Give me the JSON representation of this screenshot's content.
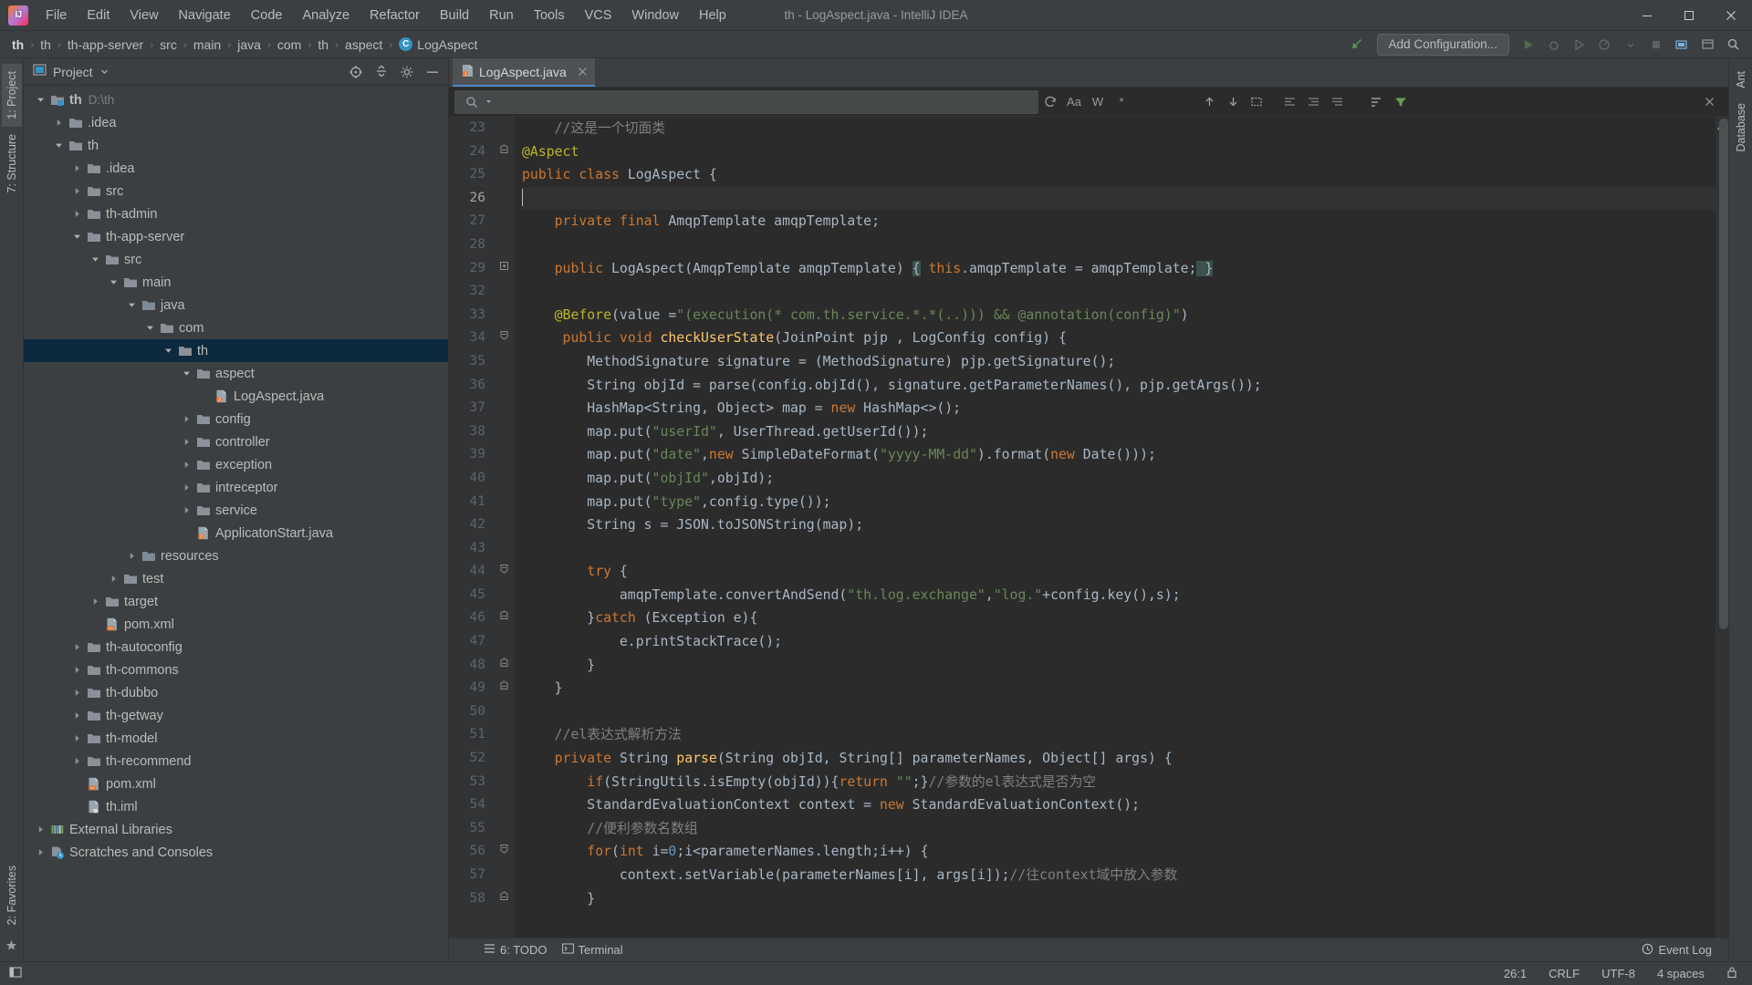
{
  "window": {
    "title": "th - LogAspect.java - IntelliJ IDEA",
    "logo_icon": "intellij-idea-logo",
    "minimize_icon": "minimize-icon",
    "maximize_icon": "maximize-icon",
    "close_icon": "close-icon"
  },
  "menubar": {
    "items": [
      {
        "label": "File"
      },
      {
        "label": "Edit"
      },
      {
        "label": "View"
      },
      {
        "label": "Navigate"
      },
      {
        "label": "Code"
      },
      {
        "label": "Analyze"
      },
      {
        "label": "Refactor"
      },
      {
        "label": "Build"
      },
      {
        "label": "Run"
      },
      {
        "label": "Tools"
      },
      {
        "label": "VCS"
      },
      {
        "label": "Window"
      },
      {
        "label": "Help"
      }
    ]
  },
  "navbar": {
    "crumbs": [
      {
        "label": "th",
        "bold": true
      },
      {
        "label": "th"
      },
      {
        "label": "th-app-server"
      },
      {
        "label": "src"
      },
      {
        "label": "main"
      },
      {
        "label": "java"
      },
      {
        "label": "com"
      },
      {
        "label": "th"
      },
      {
        "label": "aspect"
      },
      {
        "label": "LogAspect",
        "icon": "C"
      }
    ],
    "separator": "›",
    "build_icon": "hammer-icon",
    "run_config_label": "Add Configuration...",
    "icons": [
      "run-icon",
      "debug-icon",
      "run-coverage-icon",
      "profiler-icon",
      "chevron-down-icon",
      "stop-icon",
      "update-project-icon",
      "settings-icon",
      "search-everywhere-icon"
    ]
  },
  "left_strip": {
    "tabs": [
      {
        "label": "1: Project",
        "active": true
      },
      {
        "label": "7: Structure",
        "active": false
      }
    ],
    "bottom_tabs": [
      {
        "label": "2: Favorites"
      }
    ]
  },
  "right_strip": {
    "tabs": [
      {
        "label": "Ant"
      },
      {
        "label": "Database"
      }
    ]
  },
  "project_panel": {
    "title": "Project",
    "title_icon": "project-view-icon",
    "caret_icon": "chevron-down-icon",
    "locate_icon": "scroll-from-source-icon",
    "collapse_icon": "collapse-all-icon",
    "settings_icon": "gear-icon",
    "hide_icon": "hide-icon",
    "tree": [
      {
        "indent": 0,
        "arrow": "down",
        "icon": "project-folder",
        "label": "th",
        "bold": true,
        "sub": "D:\\th"
      },
      {
        "indent": 1,
        "arrow": "right",
        "icon": "folder",
        "label": ".idea"
      },
      {
        "indent": 1,
        "arrow": "down",
        "icon": "folder",
        "label": "th"
      },
      {
        "indent": 2,
        "arrow": "right",
        "icon": "folder",
        "label": ".idea"
      },
      {
        "indent": 2,
        "arrow": "right",
        "icon": "folder",
        "label": "src"
      },
      {
        "indent": 2,
        "arrow": "right",
        "icon": "folder",
        "label": "th-admin"
      },
      {
        "indent": 2,
        "arrow": "down",
        "icon": "folder",
        "label": "th-app-server"
      },
      {
        "indent": 3,
        "arrow": "down",
        "icon": "folder",
        "label": "src"
      },
      {
        "indent": 4,
        "arrow": "down",
        "icon": "folder",
        "label": "main"
      },
      {
        "indent": 5,
        "arrow": "down",
        "icon": "source-folder",
        "label": "java"
      },
      {
        "indent": 6,
        "arrow": "down",
        "icon": "package",
        "label": "com"
      },
      {
        "indent": 7,
        "arrow": "down",
        "icon": "package",
        "label": "th",
        "selected": true
      },
      {
        "indent": 8,
        "arrow": "down",
        "icon": "package",
        "label": "aspect"
      },
      {
        "indent": 9,
        "arrow": "none",
        "icon": "java-file",
        "label": "LogAspect.java"
      },
      {
        "indent": 8,
        "arrow": "right",
        "icon": "package",
        "label": "config"
      },
      {
        "indent": 8,
        "arrow": "right",
        "icon": "package",
        "label": "controller"
      },
      {
        "indent": 8,
        "arrow": "right",
        "icon": "package",
        "label": "exception"
      },
      {
        "indent": 8,
        "arrow": "right",
        "icon": "package",
        "label": "intreceptor"
      },
      {
        "indent": 8,
        "arrow": "right",
        "icon": "package",
        "label": "service"
      },
      {
        "indent": 8,
        "arrow": "none",
        "icon": "java-file",
        "label": "ApplicatonStart.java"
      },
      {
        "indent": 5,
        "arrow": "right",
        "icon": "resource-folder",
        "label": "resources"
      },
      {
        "indent": 4,
        "arrow": "right",
        "icon": "folder",
        "label": "test"
      },
      {
        "indent": 3,
        "arrow": "right",
        "icon": "folder",
        "label": "target"
      },
      {
        "indent": 3,
        "arrow": "none",
        "icon": "xml-file",
        "label": "pom.xml"
      },
      {
        "indent": 2,
        "arrow": "right",
        "icon": "folder",
        "label": "th-autoconfig"
      },
      {
        "indent": 2,
        "arrow": "right",
        "icon": "folder",
        "label": "th-commons"
      },
      {
        "indent": 2,
        "arrow": "right",
        "icon": "folder",
        "label": "th-dubbo"
      },
      {
        "indent": 2,
        "arrow": "right",
        "icon": "folder",
        "label": "th-getway"
      },
      {
        "indent": 2,
        "arrow": "right",
        "icon": "folder",
        "label": "th-model"
      },
      {
        "indent": 2,
        "arrow": "right",
        "icon": "folder",
        "label": "th-recommend"
      },
      {
        "indent": 2,
        "arrow": "none",
        "icon": "xml-file",
        "label": "pom.xml"
      },
      {
        "indent": 2,
        "arrow": "none",
        "icon": "iml-file",
        "label": "th.iml"
      },
      {
        "indent": 0,
        "arrow": "right",
        "icon": "libraries",
        "label": "External Libraries"
      },
      {
        "indent": 0,
        "arrow": "right",
        "icon": "scratches",
        "label": "Scratches and Consoles"
      }
    ]
  },
  "editor": {
    "tab": {
      "label": "LogAspect.java",
      "icon": "java-file",
      "close_icon": "close-icon"
    },
    "findbar": {
      "search_icon": "search-icon",
      "dropdown_icon": "chevron-down-icon",
      "value": "",
      "placeholder": "",
      "history_icon": "history-icon",
      "match_case_icon": "Aa",
      "words_icon": "W",
      "regex_icon": "*",
      "prev_icon": "arrow-up-icon",
      "next_icon": "arrow-down-icon",
      "select_all_icon": "select-all-icon",
      "filter_icon": "filter-icon",
      "expand_icon": "expand-icon",
      "collapse_icon": "collapse-icon",
      "close_icon": "close-icon"
    },
    "caret_position": "26:1",
    "inspection_status": "ok-check-icon",
    "lines": [
      {
        "n": "23",
        "fold": "",
        "html": "    <span class=\"cmt\">//这是一个切面类</span>"
      },
      {
        "n": "24",
        "fold": "minus",
        "html": "<span class=\"ann\">@Aspect</span>"
      },
      {
        "n": "25",
        "fold": "",
        "html": "<span class=\"kw\">public class</span> <span class=\"txt\">LogAspect</span> {"
      },
      {
        "n": "26",
        "fold": "",
        "html": "<span class=\"caret\"></span>",
        "current": true
      },
      {
        "n": "27",
        "fold": "",
        "html": "    <span class=\"kw\">private final</span> AmqpTemplate amqpTemplate;"
      },
      {
        "n": "28",
        "fold": "",
        "html": ""
      },
      {
        "n": "29",
        "fold": "plus",
        "html": "    <span class=\"kw\">public</span> <span class=\"txt\">LogAspect</span>(AmqpTemplate amqpTemplate) <span class=\"hl\">{</span> <span class=\"kw\">this</span>.amqpTemplate = amqpTemplate;<span class=\"hl\"> }</span>"
      },
      {
        "n": "32",
        "fold": "",
        "html": ""
      },
      {
        "n": "33",
        "fold": "",
        "html": "    <span class=\"ann\">@Before</span>(value =<span class=\"str\">\"(execution(* com.th.service.*.*(..))) &amp;&amp; @annotation(config)\"</span>)"
      },
      {
        "n": "34",
        "fold": "minus2",
        "html": "     <span class=\"kw\">public void</span> <span class=\"fn\">checkUserState</span>(JoinPoint pjp , LogConfig config) {",
        "current": false
      },
      {
        "n": "35",
        "fold": "",
        "html": "        MethodSignature signature = (MethodSignature) pjp.getSignature();"
      },
      {
        "n": "36",
        "fold": "",
        "html": "        String objId = parse(config.objId(), signature.getParameterNames(), pjp.getArgs());"
      },
      {
        "n": "37",
        "fold": "",
        "html": "        HashMap&lt;String, Object&gt; map = <span class=\"kw\">new</span> HashMap&lt;&gt;();"
      },
      {
        "n": "38",
        "fold": "",
        "html": "        map.put(<span class=\"str\">\"userId\"</span>, UserThread.getUserId());"
      },
      {
        "n": "39",
        "fold": "",
        "html": "        map.put(<span class=\"str\">\"date\"</span>,<span class=\"kw\">new</span> SimpleDateFormat(<span class=\"str\">\"yyyy-MM-dd\"</span>).format(<span class=\"kw\">new</span> Date()));"
      },
      {
        "n": "40",
        "fold": "",
        "html": "        map.put(<span class=\"str\">\"objId\"</span>,objId);"
      },
      {
        "n": "41",
        "fold": "",
        "html": "        map.put(<span class=\"str\">\"type\"</span>,config.type());"
      },
      {
        "n": "42",
        "fold": "",
        "html": "        String s = JSON.toJSONString(map);"
      },
      {
        "n": "43",
        "fold": "",
        "html": ""
      },
      {
        "n": "44",
        "fold": "minus2",
        "html": "        <span class=\"kw\">try</span> {"
      },
      {
        "n": "45",
        "fold": "",
        "html": "            amqpTemplate.convertAndSend(<span class=\"str\">\"th.log.exchange\"</span>,<span class=\"str\">\"log.\"</span>+config.key(),s);"
      },
      {
        "n": "46",
        "fold": "minus",
        "html": "        }<span class=\"kw\">catch</span> (Exception e){"
      },
      {
        "n": "47",
        "fold": "",
        "html": "            e.printStackTrace();"
      },
      {
        "n": "48",
        "fold": "minus",
        "html": "        }"
      },
      {
        "n": "49",
        "fold": "minus",
        "html": "    }"
      },
      {
        "n": "50",
        "fold": "",
        "html": ""
      },
      {
        "n": "51",
        "fold": "",
        "html": "    <span class=\"cmt\">//el表达式解析方法</span>"
      },
      {
        "n": "52",
        "fold": "",
        "html": "    <span class=\"kw\">private</span> String <span class=\"fn\">parse</span>(String objId, String[] parameterNames, Object[] args) {"
      },
      {
        "n": "53",
        "fold": "",
        "html": "        <span class=\"kw\">if</span>(StringUtils.isEmpty(objId)){<span class=\"kw\">return</span> <span class=\"str\">\"\"</span>;}<span class=\"cmt\">//参数的el表达式是否为空</span>"
      },
      {
        "n": "54",
        "fold": "",
        "html": "        StandardEvaluationContext context = <span class=\"kw\">new</span> StandardEvaluationContext();"
      },
      {
        "n": "55",
        "fold": "",
        "html": "        <span class=\"cmt\">//便利参数名数组</span>"
      },
      {
        "n": "56",
        "fold": "minus2",
        "html": "        <span class=\"kw\">for</span>(<span class=\"kw\">int</span> i=<span class=\"num\">0</span>;i&lt;parameterNames.length;i++) {"
      },
      {
        "n": "57",
        "fold": "",
        "html": "            context.setVariable(parameterNames[i], args[i]);<span class=\"cmt\">//往context域中放入参数</span>"
      },
      {
        "n": "58",
        "fold": "minus",
        "html": "        }"
      }
    ]
  },
  "bottombar": {
    "items": [
      {
        "label": "6: TODO",
        "icon": "todo-icon"
      },
      {
        "label": "Terminal",
        "icon": "terminal-icon"
      }
    ],
    "event_log": {
      "label": "Event Log",
      "icon": "event-log-icon"
    }
  },
  "statusbar": {
    "left_icon": "show-tool-windows-icon",
    "right": [
      {
        "label": "26:1",
        "name": "caret-position"
      },
      {
        "label": "CRLF",
        "name": "line-separator"
      },
      {
        "label": "UTF-8",
        "name": "file-encoding"
      },
      {
        "label": "4 spaces",
        "name": "indent-size"
      },
      {
        "label": "",
        "name": "lock-icon"
      }
    ]
  },
  "colors": {
    "chrome": "#3c3f41",
    "editor_bg": "#2b2b2b",
    "gutter_bg": "#313335",
    "selection": "#0d293e",
    "accent": "#4a88c7",
    "keyword": "#cc7832",
    "string": "#6a8759",
    "comment": "#808080",
    "annotation": "#bbb529",
    "number": "#6897bb",
    "method": "#ffc66d",
    "text": "#a9b7c6"
  }
}
